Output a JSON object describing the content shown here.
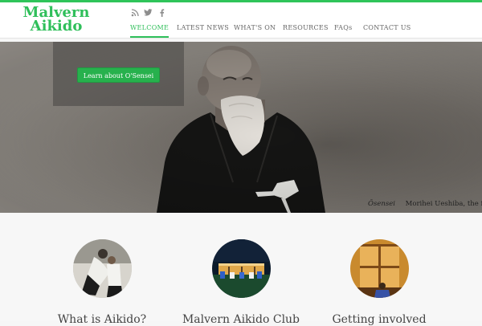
{
  "site": {
    "logo_line1": "Malvern",
    "logo_line2": "Aikido"
  },
  "social": [
    {
      "icon": "rss-icon",
      "glyph": "◥"
    },
    {
      "icon": "twitter-icon",
      "glyph": "✉"
    },
    {
      "icon": "facebook-icon",
      "glyph": "f"
    }
  ],
  "nav": {
    "items": [
      {
        "label": "WELCOME",
        "active": true
      },
      {
        "label": "LATEST NEWS",
        "active": false
      },
      {
        "label": "WHAT'S ON",
        "active": false
      },
      {
        "label": "RESOURCES",
        "active": false
      },
      {
        "label": "FAQs",
        "active": false
      },
      {
        "label": "CONTACT US",
        "active": false
      }
    ]
  },
  "hero": {
    "button_label": "Learn about O'Sensei",
    "caption_name": "Ōsensei",
    "caption_text": "Morihei Ueshiba, the fo"
  },
  "features": [
    {
      "title": "What is Aikido?"
    },
    {
      "title": "Malvern Aikido Club"
    },
    {
      "title": "Getting involved"
    }
  ],
  "colors": {
    "accent": "#2fbf5a",
    "button": "#27b14d"
  }
}
